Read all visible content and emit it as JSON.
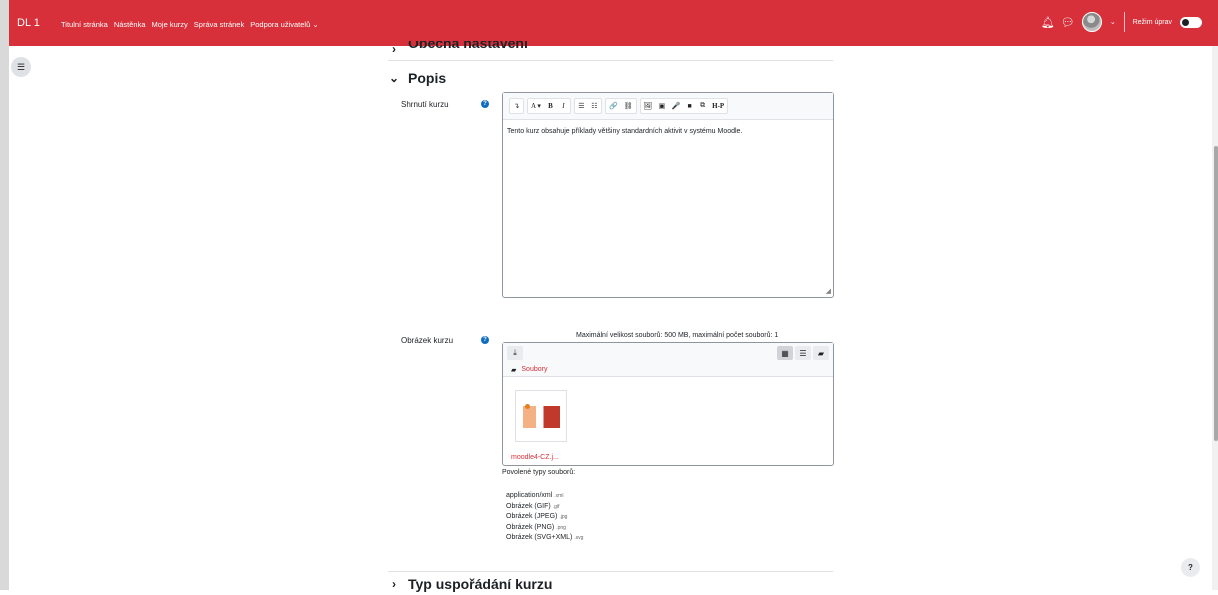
{
  "colors": {
    "brand": "#d7303b",
    "link": "#d7303b",
    "help": "#0f6cbf"
  },
  "topbar": {
    "brand": "DL 1",
    "nav": [
      "Titulní stránka",
      "Nástěnka",
      "Moje kurzy",
      "Správa stránek",
      "Podpora uživatelů"
    ],
    "nav_dropdown_caret": "⌄",
    "edit_mode_label": "Režim úprav",
    "edit_mode_on": false
  },
  "sections": {
    "general": "Obecná nastavení",
    "description": "Popis",
    "layout": "Typ uspořádání kurzu"
  },
  "summary": {
    "label": "Shrnutí kurzu",
    "text": "Tento kurz obsahuje příklady většiny standardních aktivit v systému Moodle."
  },
  "toolbar": {
    "buttons": [
      "↴",
      "A ▾",
      "B",
      "I",
      "☰",
      "☷",
      "🔗",
      "⛓",
      "🖼",
      "▣",
      "🎤",
      "■",
      "⧉",
      "H-P"
    ]
  },
  "image": {
    "label": "Obrázek kurzu",
    "limits": "Maximální velikost souborů: 500 MB, maximální počet souborů: 1",
    "folder": "Soubory",
    "filename": "moodle4-CZ.j...",
    "allowed_title": "Povolené typy souborů:",
    "types": [
      {
        "name": "application/xml",
        "ext": ".xml"
      },
      {
        "name": "Obrázek (GIF)",
        "ext": ".gif"
      },
      {
        "name": "Obrázek (JPEG)",
        "ext": ".jpg"
      },
      {
        "name": "Obrázek (PNG)",
        "ext": ".png"
      },
      {
        "name": "Obrázek (SVG+XML)",
        "ext": ".svg"
      }
    ]
  },
  "help_fab": "?"
}
